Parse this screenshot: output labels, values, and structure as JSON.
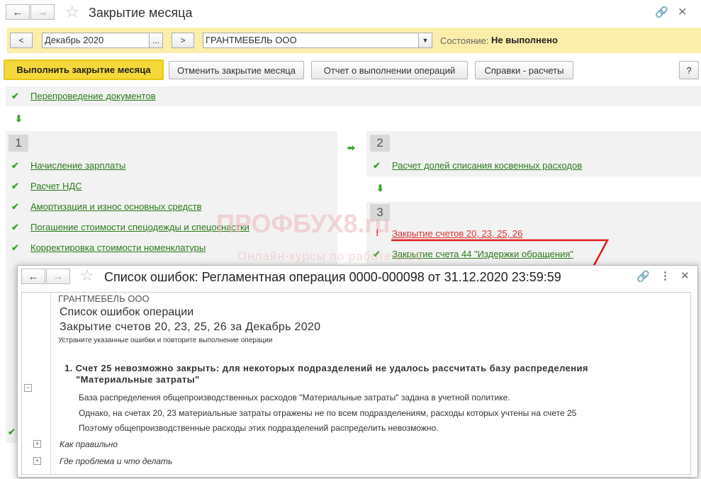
{
  "window": {
    "title": "Закрытие месяца"
  },
  "period": {
    "prev": "<",
    "value": "Декабрь 2020",
    "choose": "...",
    "next": ">"
  },
  "org": {
    "value": "ГРАНТМЕБЕЛЬ ООО"
  },
  "state": {
    "label": "Состояние:",
    "value": "Не выполнено"
  },
  "toolbar": {
    "run": "Выполнить закрытие месяца",
    "cancel": "Отменить закрытие месяца",
    "report": "Отчет о выполнении операций",
    "calc": "Справки - расчеты",
    "help": "?"
  },
  "steps": {
    "pre": "Перепроведение документов",
    "s1": {
      "num": "1",
      "items": [
        "Начисление зарплаты",
        "Расчет НДС",
        "Амортизация и износ основных средств",
        "Погашение стоимости спецодежды и спецоснастки",
        "Корректировка стоимости номенклатуры"
      ]
    },
    "s2": {
      "num": "2",
      "items": [
        "Расчет долей списания косвенных расходов"
      ]
    },
    "s3": {
      "num": "3",
      "items": [
        "Закрытие счетов 20, 23, 25, 26",
        "Закрытие счета 44 \"Издержки обращения\""
      ]
    }
  },
  "watermark": {
    "brand": "ПРОФБУХ8.ru",
    "tagline": "Онлайн-курсы по работе в 1С"
  },
  "dialog": {
    "title": "Список ошибок: Регламентная операция 0000-000098 от 31.12.2020 23:59:59",
    "org": "ГРАНТМЕБЕЛЬ ООО",
    "heading1": "Список ошибок операции",
    "heading2": "Закрытие счетов 20, 23, 25, 26 за Декабрь 2020",
    "hint": "Устраните указанные ошибки и повторите выполнение операции",
    "error_title_1": "1. Счет 25 невозможно закрыть: для некоторых подразделений не удалось рассчитать базу распределения",
    "error_title_2": "\"Материальные затраты\"",
    "line1": "База распределения общепроизводственных расходов \"Материальные затраты\" задана в учетной политике.",
    "line2": "Однако, на счетах 20, 23 материальные затраты отражены не по всем подразделениям, расходы которых учтены на счете 25",
    "line3": "Поэтому общепроизводственные расходы этих подразделений распределить невозможно.",
    "section1": "Как правильно",
    "section2": "Где проблема и что делать"
  }
}
